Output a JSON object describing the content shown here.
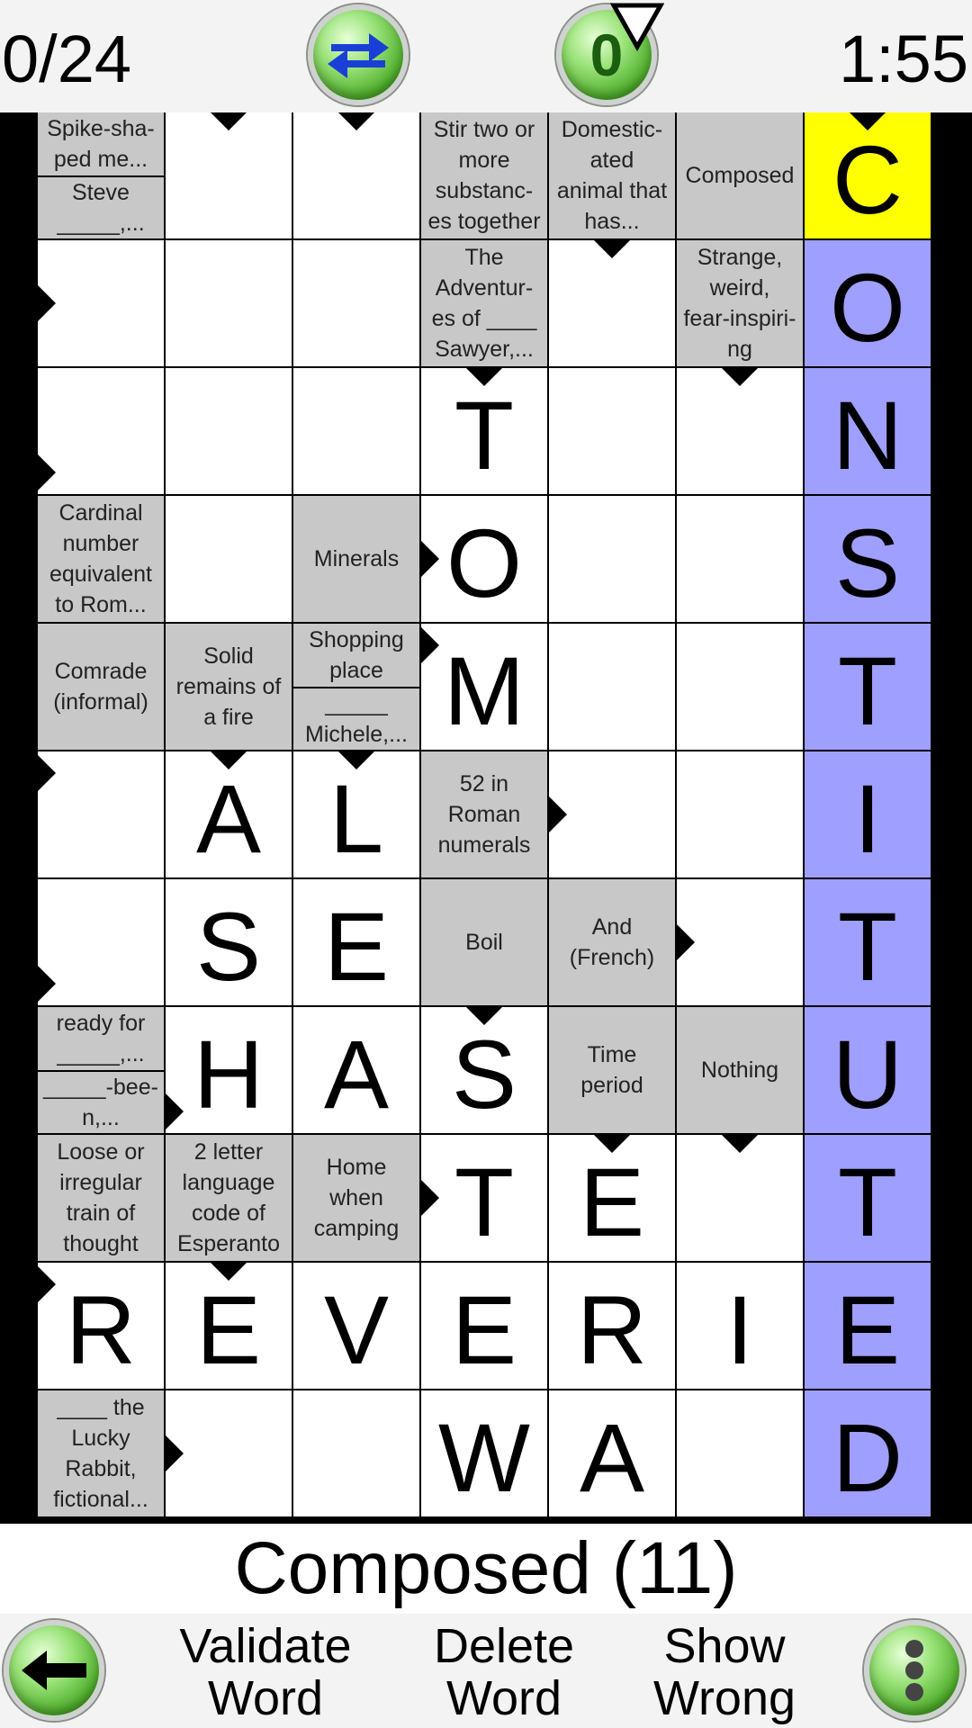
{
  "header": {
    "score": "0/24",
    "timer": "1:55",
    "hint_count": "0"
  },
  "current_clue": "Composed (11)",
  "footer": {
    "validate_line1": "Validate",
    "validate_line2": "Word",
    "delete_line1": "Delete",
    "delete_line2": "Word",
    "show_line1": "Show",
    "show_line2": "Wrong"
  },
  "grid": {
    "rows": 11,
    "cols": 7,
    "colors": {
      "white": "#ffffff",
      "clue": "#c8c8c8",
      "selected": "#ffff00",
      "highlight": "#9f9fff"
    },
    "cells": [
      [
        {
          "type": "clue2",
          "top": "Spike-sha-\nped me...",
          "bottom": "Steve\n_____,..."
        },
        {
          "type": "letter",
          "value": "",
          "marker": "down"
        },
        {
          "type": "letter",
          "value": "",
          "marker": "down"
        },
        {
          "type": "clue",
          "text": "Stir two or\nmore\nsubstanc-\nes together"
        },
        {
          "type": "clue",
          "text": "Domestic-\nated\nanimal that\nhas..."
        },
        {
          "type": "clue",
          "text": "Composed"
        },
        {
          "type": "letter",
          "value": "C",
          "state": "selected",
          "marker": "down"
        }
      ],
      [
        {
          "type": "letter",
          "value": "",
          "marker": "right"
        },
        {
          "type": "letter",
          "value": ""
        },
        {
          "type": "letter",
          "value": ""
        },
        {
          "type": "clue",
          "text": "The\nAdventur-\nes of ____\nSawyer,..."
        },
        {
          "type": "letter",
          "value": "",
          "marker": "down"
        },
        {
          "type": "clue",
          "text": "Strange,\nweird,\nfear-inspiri-\nng"
        },
        {
          "type": "letter",
          "value": "O",
          "state": "highlight"
        }
      ],
      [
        {
          "type": "letter",
          "value": "",
          "marker": "right-low"
        },
        {
          "type": "letter",
          "value": ""
        },
        {
          "type": "letter",
          "value": ""
        },
        {
          "type": "letter",
          "value": "T",
          "marker": "down"
        },
        {
          "type": "letter",
          "value": ""
        },
        {
          "type": "letter",
          "value": "",
          "marker": "down"
        },
        {
          "type": "letter",
          "value": "N",
          "state": "highlight"
        }
      ],
      [
        {
          "type": "clue",
          "text": "Cardinal\nnumber\nequivalent\nto Rom..."
        },
        {
          "type": "letter",
          "value": ""
        },
        {
          "type": "clue",
          "text": "Minerals"
        },
        {
          "type": "letter",
          "value": "O",
          "marker": "right"
        },
        {
          "type": "letter",
          "value": ""
        },
        {
          "type": "letter",
          "value": ""
        },
        {
          "type": "letter",
          "value": "S",
          "state": "highlight"
        }
      ],
      [
        {
          "type": "clue",
          "text": "Comrade\n(informal)"
        },
        {
          "type": "clue",
          "text": "Solid\nremains of\na fire"
        },
        {
          "type": "clue2",
          "top": "Shopping\nplace",
          "bottom": "_____\nMichele,..."
        },
        {
          "type": "letter",
          "value": "M",
          "marker": "right-high"
        },
        {
          "type": "letter",
          "value": ""
        },
        {
          "type": "letter",
          "value": ""
        },
        {
          "type": "letter",
          "value": "T",
          "state": "highlight"
        }
      ],
      [
        {
          "type": "letter",
          "value": "",
          "marker": "right-high"
        },
        {
          "type": "letter",
          "value": "A",
          "marker": "down"
        },
        {
          "type": "letter",
          "value": "L",
          "marker": "down"
        },
        {
          "type": "clue",
          "text": "52 in\nRoman\nnumerals"
        },
        {
          "type": "letter",
          "value": "",
          "marker": "right"
        },
        {
          "type": "letter",
          "value": ""
        },
        {
          "type": "letter",
          "value": "I",
          "state": "highlight"
        }
      ],
      [
        {
          "type": "letter",
          "value": "",
          "marker": "right-low"
        },
        {
          "type": "letter",
          "value": "S"
        },
        {
          "type": "letter",
          "value": "E"
        },
        {
          "type": "clue",
          "text": "Boil"
        },
        {
          "type": "clue",
          "text": "And\n(French)"
        },
        {
          "type": "letter",
          "value": "",
          "marker": "right"
        },
        {
          "type": "letter",
          "value": "T",
          "state": "highlight"
        }
      ],
      [
        {
          "type": "clue2",
          "top": "ready for\n_____,...",
          "bottom": "_____-bee-\nn,..."
        },
        {
          "type": "letter",
          "value": "H",
          "marker": "right-low"
        },
        {
          "type": "letter",
          "value": "A"
        },
        {
          "type": "letter",
          "value": "S",
          "marker": "down"
        },
        {
          "type": "clue",
          "text": "Time\nperiod"
        },
        {
          "type": "clue",
          "text": "Nothing"
        },
        {
          "type": "letter",
          "value": "U",
          "state": "highlight"
        }
      ],
      [
        {
          "type": "clue",
          "text": "Loose or\nirregular\ntrain of\nthought"
        },
        {
          "type": "clue",
          "text": "2 letter\nlanguage\ncode of\nEsperanto"
        },
        {
          "type": "clue",
          "text": "Home\nwhen\ncamping"
        },
        {
          "type": "letter",
          "value": "T",
          "marker": "right"
        },
        {
          "type": "letter",
          "value": "E",
          "marker": "down"
        },
        {
          "type": "letter",
          "value": "",
          "marker": "down"
        },
        {
          "type": "letter",
          "value": "T",
          "state": "highlight"
        }
      ],
      [
        {
          "type": "letter",
          "value": "R",
          "marker": "right-high"
        },
        {
          "type": "letter",
          "value": "E",
          "marker": "down"
        },
        {
          "type": "letter",
          "value": "V"
        },
        {
          "type": "letter",
          "value": "E"
        },
        {
          "type": "letter",
          "value": "R"
        },
        {
          "type": "letter",
          "value": "I"
        },
        {
          "type": "letter",
          "value": "E",
          "state": "highlight"
        }
      ],
      [
        {
          "type": "clue",
          "text": "____ the\nLucky\nRabbit,\nfictional..."
        },
        {
          "type": "letter",
          "value": "",
          "marker": "right"
        },
        {
          "type": "letter",
          "value": ""
        },
        {
          "type": "letter",
          "value": "W"
        },
        {
          "type": "letter",
          "value": "A"
        },
        {
          "type": "letter",
          "value": ""
        },
        {
          "type": "letter",
          "value": "D",
          "state": "highlight"
        }
      ]
    ]
  }
}
